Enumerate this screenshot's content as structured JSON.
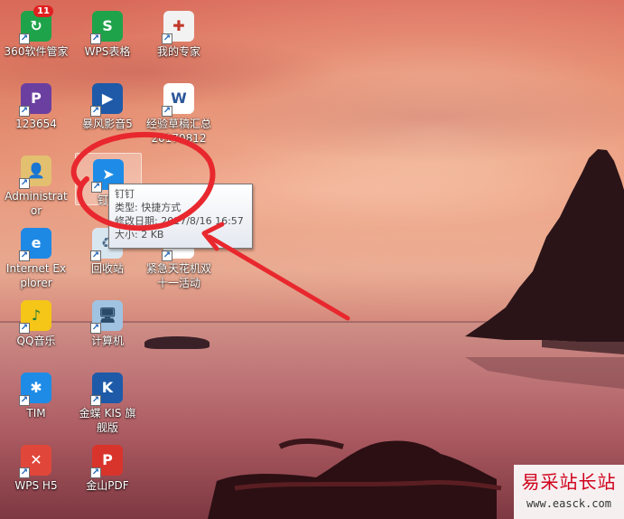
{
  "desktop": {
    "icons": [
      {
        "id": "360",
        "label": "360软件管家",
        "badge": "11",
        "icon": "360-software-manager-icon",
        "color": "#1fa34a"
      },
      {
        "id": "wps-sheets",
        "label": "WPS表格",
        "icon": "wps-spreadsheet-icon",
        "color": "#1fa34a"
      },
      {
        "id": "my-expert",
        "label": "我的专家",
        "icon": "doctor-expert-icon",
        "color": "#f2f2f2"
      },
      {
        "id": "app-123654",
        "label": "123654",
        "icon": "plugin-app-icon",
        "color": "#6b3fa0"
      },
      {
        "id": "baofeng",
        "label": "暴风影音5",
        "icon": "film-player-icon",
        "color": "#1e5aa8"
      },
      {
        "id": "draft-doc",
        "label": "经验草稿汇总20170812",
        "icon": "word-document-icon",
        "color": "#ffffff"
      },
      {
        "id": "administrator",
        "label": "Administrator",
        "icon": "user-folder-icon",
        "color": "#e3c070"
      },
      {
        "id": "dingding",
        "label": "钉钉",
        "icon": "dingtalk-icon",
        "color": "#1e8ce6"
      },
      {
        "id": "ie",
        "label": "Internet Explorer",
        "icon": "internet-explorer-icon",
        "color": "#1e88e5"
      },
      {
        "id": "recycle",
        "label": "回收站",
        "icon": "recycle-bin-icon",
        "color": "#d8e6f0"
      },
      {
        "id": "activity",
        "label": "紧急天花机双十一活动",
        "icon": "document-icon",
        "color": "#ffffff"
      },
      {
        "id": "qqmusic",
        "label": "QQ音乐",
        "icon": "qq-music-icon",
        "color": "#f5c518"
      },
      {
        "id": "computer",
        "label": "计算机",
        "icon": "computer-icon",
        "color": "#9fc3e0"
      },
      {
        "id": "tim",
        "label": "TIM",
        "icon": "tim-icon",
        "color": "#1e8ce6"
      },
      {
        "id": "kis",
        "label": "金蝶 KIS 旗舰版",
        "icon": "kingdee-kis-icon",
        "color": "#1e5aa8"
      },
      {
        "id": "wps-h5",
        "label": "WPS H5",
        "icon": "wps-h5-icon",
        "color": "#e0473a"
      },
      {
        "id": "jinshan-pdf",
        "label": "金山PDF",
        "icon": "pdf-icon",
        "color": "#d9342b"
      }
    ]
  },
  "tooltip": {
    "title": "钉钉",
    "type_line": "类型: 快捷方式",
    "modified_line": "修改日期: 2017/8/16 16:57",
    "size_line": "大小: 2 KB"
  },
  "annotation": {
    "color": "#e8282e"
  },
  "watermark": {
    "title": "易采站长站",
    "url": "www.easck.com"
  }
}
